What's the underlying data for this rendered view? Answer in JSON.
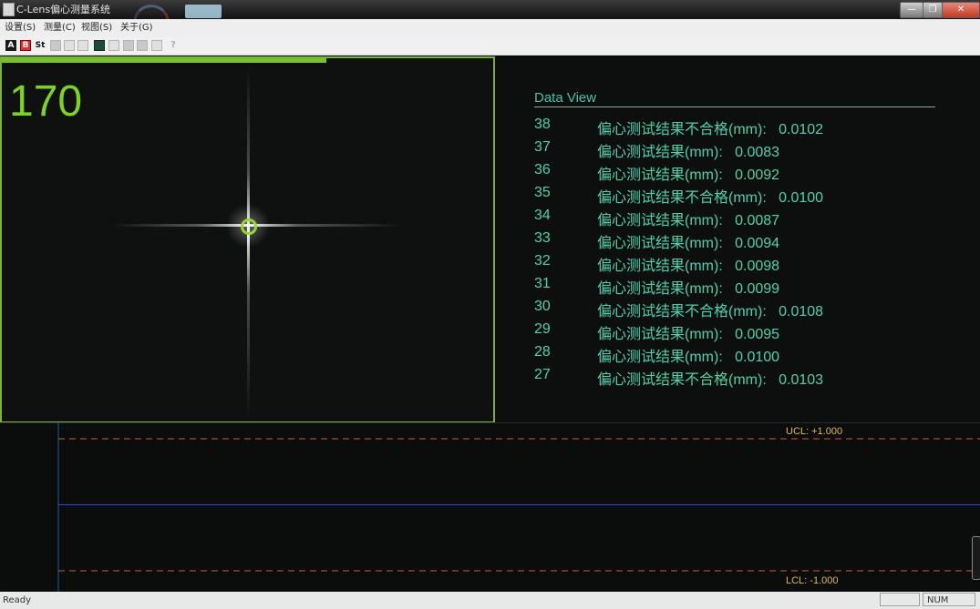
{
  "window": {
    "title": "C-Lens偏心测量系统"
  },
  "menu": [
    {
      "label": "设置(S)"
    },
    {
      "label": "测量(C)"
    },
    {
      "label": "视图(S)"
    },
    {
      "label": "关于(G)"
    }
  ],
  "toolbar": [
    {
      "label": "A",
      "icon": "stop-icon",
      "enabled": true
    },
    {
      "label": "B",
      "icon": "camera-icon",
      "enabled": true
    },
    {
      "label": "St",
      "icon": "start-icon",
      "enabled": true
    },
    {
      "label": "",
      "icon": "disabled-icon",
      "enabled": false
    },
    {
      "label": "",
      "icon": "disabled-icon",
      "enabled": false
    },
    {
      "label": "",
      "icon": "disabled-icon",
      "enabled": false
    },
    {
      "label": "",
      "icon": "grid-icon",
      "enabled": true
    },
    {
      "label": "",
      "icon": "disabled-icon",
      "enabled": false
    },
    {
      "label": "",
      "icon": "disabled-icon",
      "enabled": false
    },
    {
      "label": "",
      "icon": "disabled-icon",
      "enabled": false
    },
    {
      "label": "",
      "icon": "disabled-icon",
      "enabled": false
    },
    {
      "label": "",
      "icon": "help-icon",
      "enabled": false
    }
  ],
  "image_view": {
    "frame_count": "170",
    "progress": 0.66
  },
  "data_view": {
    "title": "Data View",
    "rows": [
      {
        "index": "38",
        "text": "偏心测试结果不合格(mm):   0.0102"
      },
      {
        "index": "37",
        "text": "偏心测试结果(mm):   0.0083"
      },
      {
        "index": "36",
        "text": "偏心测试结果(mm):   0.0092"
      },
      {
        "index": "35",
        "text": "偏心测试结果不合格(mm):   0.0100"
      },
      {
        "index": "34",
        "text": "偏心测试结果(mm):   0.0087"
      },
      {
        "index": "33",
        "text": "偏心测试结果(mm):   0.0094"
      },
      {
        "index": "32",
        "text": "偏心测试结果(mm):   0.0098"
      },
      {
        "index": "31",
        "text": "偏心测试结果(mm):   0.0099"
      },
      {
        "index": "30",
        "text": "偏心测试结果不合格(mm):   0.0108"
      },
      {
        "index": "29",
        "text": "偏心测试结果(mm):   0.0095"
      },
      {
        "index": "28",
        "text": "偏心测试结果(mm):   0.0100"
      },
      {
        "index": "27",
        "text": "偏心测试结果不合格(mm):   0.0103"
      }
    ]
  },
  "control_chart": {
    "ucl_label": "UCL:  +1.000",
    "lcl_label": "LCL:  -1.000",
    "ucl": 1.0,
    "lcl": -1.0,
    "center": 0.0
  },
  "status": {
    "left": "Ready",
    "num": "NUM"
  },
  "colors": {
    "accent_green": "#7ed321",
    "data_text": "#4fd1ad",
    "limit_line": "#d2573e",
    "center_line": "#2f4bd1",
    "limit_label": "#e3b84a"
  }
}
